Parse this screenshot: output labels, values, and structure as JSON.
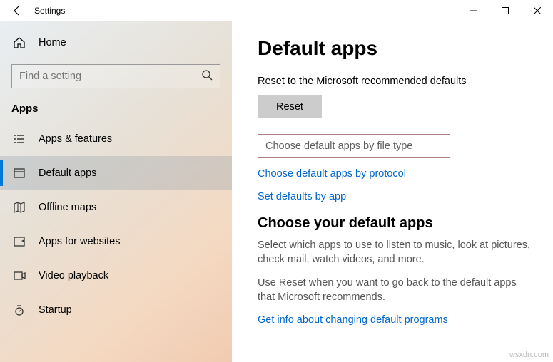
{
  "titlebar": {
    "title": "Settings"
  },
  "sidebar": {
    "home": "Home",
    "search_placeholder": "Find a setting",
    "section": "Apps",
    "items": [
      {
        "label": "Apps & features"
      },
      {
        "label": "Default apps"
      },
      {
        "label": "Offline maps"
      },
      {
        "label": "Apps for websites"
      },
      {
        "label": "Video playback"
      },
      {
        "label": "Startup"
      }
    ]
  },
  "main": {
    "heading": "Default apps",
    "reset_text": "Reset to the Microsoft recommended defaults",
    "reset_button": "Reset",
    "link_filetype": "Choose default apps by file type",
    "link_protocol": "Choose default apps by protocol",
    "link_byapp": "Set defaults by app",
    "subheading": "Choose your default apps",
    "para1": "Select which apps to use to listen to music, look at pictures, check mail, watch videos, and more.",
    "para2": "Use Reset when you want to go back to the default apps that Microsoft recommends.",
    "info_link": "Get info about changing default programs"
  },
  "watermark": "wsxdn.com"
}
